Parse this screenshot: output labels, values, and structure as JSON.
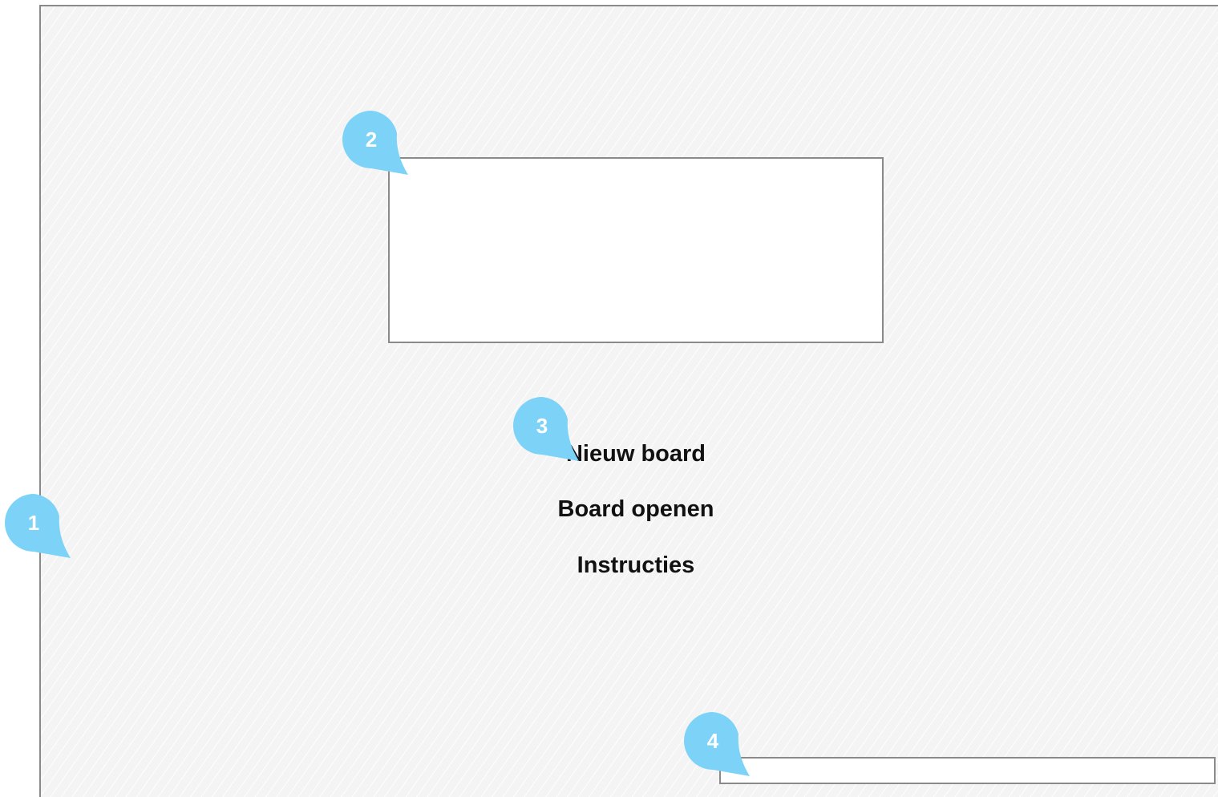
{
  "menu": {
    "items": [
      {
        "label": "Nieuw board"
      },
      {
        "label": "Board openen"
      },
      {
        "label": "Instructies"
      }
    ]
  },
  "markers": [
    {
      "label": "1"
    },
    {
      "label": "2"
    },
    {
      "label": "3"
    },
    {
      "label": "4"
    }
  ],
  "colors": {
    "marker": "#7dd3f7",
    "border": "#8a8a8a",
    "background": "#f4f4f4"
  }
}
